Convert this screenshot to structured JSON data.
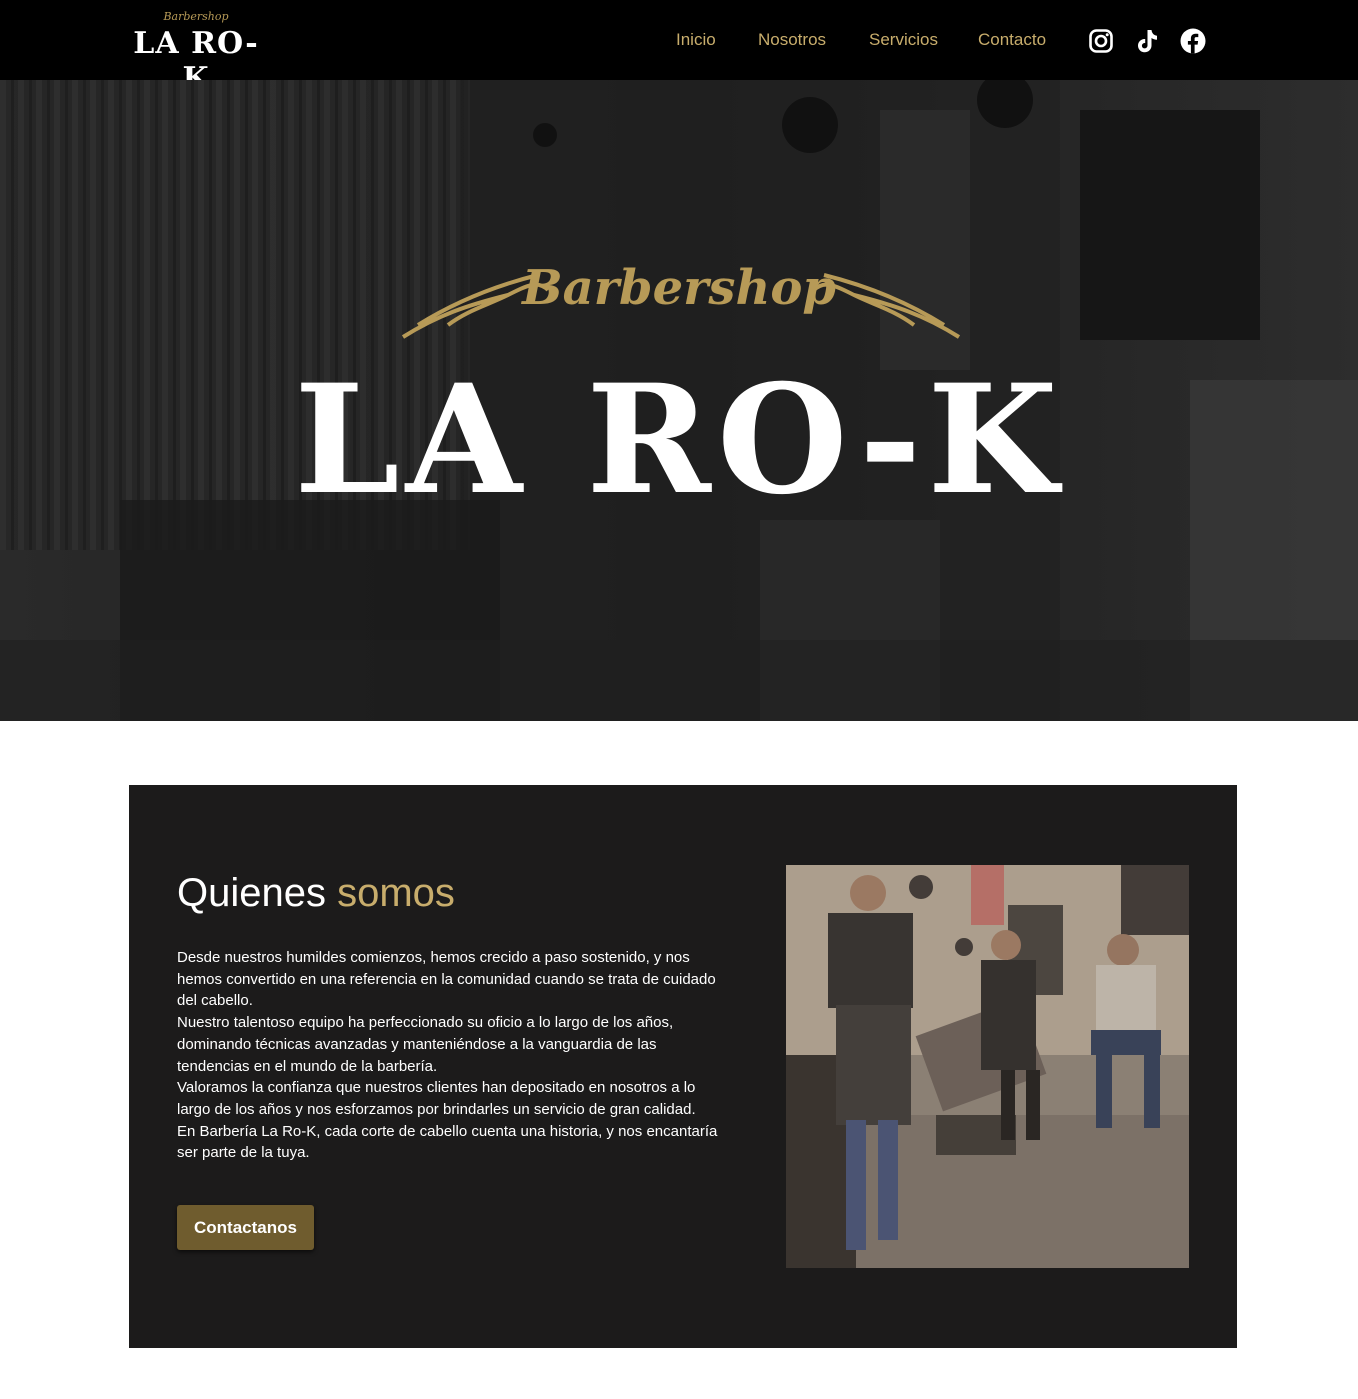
{
  "header": {
    "brand_sub": "Barbershop",
    "brand_name": "LA RO-K",
    "nav": [
      "Inicio",
      "Nosotros",
      "Servicios",
      "Contacto"
    ],
    "social_icons": [
      "instagram-icon",
      "tiktok-icon",
      "facebook-icon"
    ],
    "nav_color": "#c8ad6c"
  },
  "hero": {
    "script": "Barbershop",
    "title": "LA RO-K",
    "accent_color": "#b79a57"
  },
  "about": {
    "title_main": "Quienes",
    "title_accent": "somos",
    "paragraphs": [
      "Desde nuestros humildes comienzos, hemos crecido a paso sostenido, y nos hemos convertido en una referencia en la comunidad cuando se trata de cuidado del cabello.",
      "Nuestro talentoso equipo ha perfeccionado su oficio a lo largo de los años, dominando técnicas avanzadas y manteniéndose a la vanguardia de las tendencias en el mundo de la barbería.",
      "Valoramos la confianza que nuestros clientes han depositado en nosotros a lo largo de los años y nos esforzamos por brindarles un servicio de gran calidad.",
      "En Barbería La Ro-K, cada corte de cabello cuenta una historia, y nos encantaría ser parte de la tuya."
    ],
    "button_label": "Contactanos",
    "button_color": "#6f5c2e"
  }
}
